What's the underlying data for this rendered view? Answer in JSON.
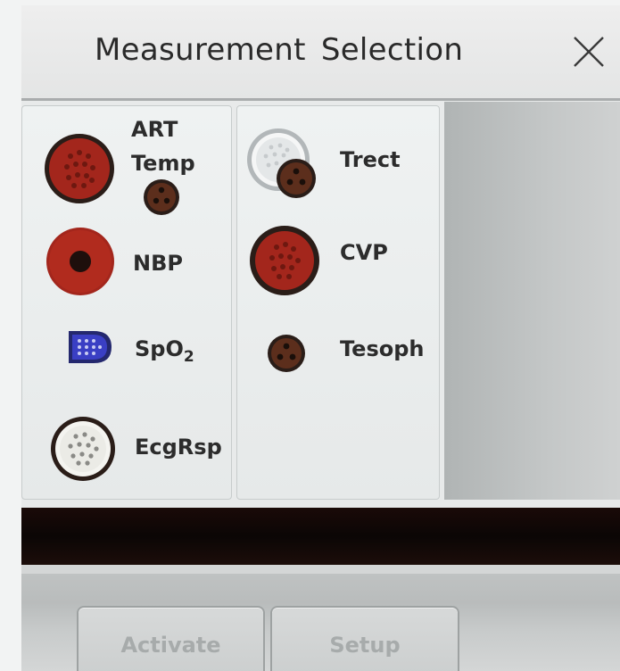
{
  "dialog": {
    "title": "Measurement Selection",
    "close_icon": "close-icon"
  },
  "left_panel": {
    "items": [
      {
        "label_line1": "ART",
        "label_line2": "Temp"
      },
      {
        "label": "NBP"
      },
      {
        "label_main": "SpO",
        "label_sub": "2"
      },
      {
        "label": "EcgRsp"
      }
    ]
  },
  "right_panel": {
    "items": [
      {
        "label": "Trect"
      },
      {
        "label": "CVP"
      },
      {
        "label": "Tesoph"
      }
    ]
  },
  "buttons": {
    "activate": "Activate",
    "setup": "Setup"
  },
  "colors": {
    "connector_red": "#a3261c",
    "connector_dark": "#2a1d18",
    "connector_brown": "#5c2e1c",
    "spo2_blue": "#3a3fc4"
  }
}
